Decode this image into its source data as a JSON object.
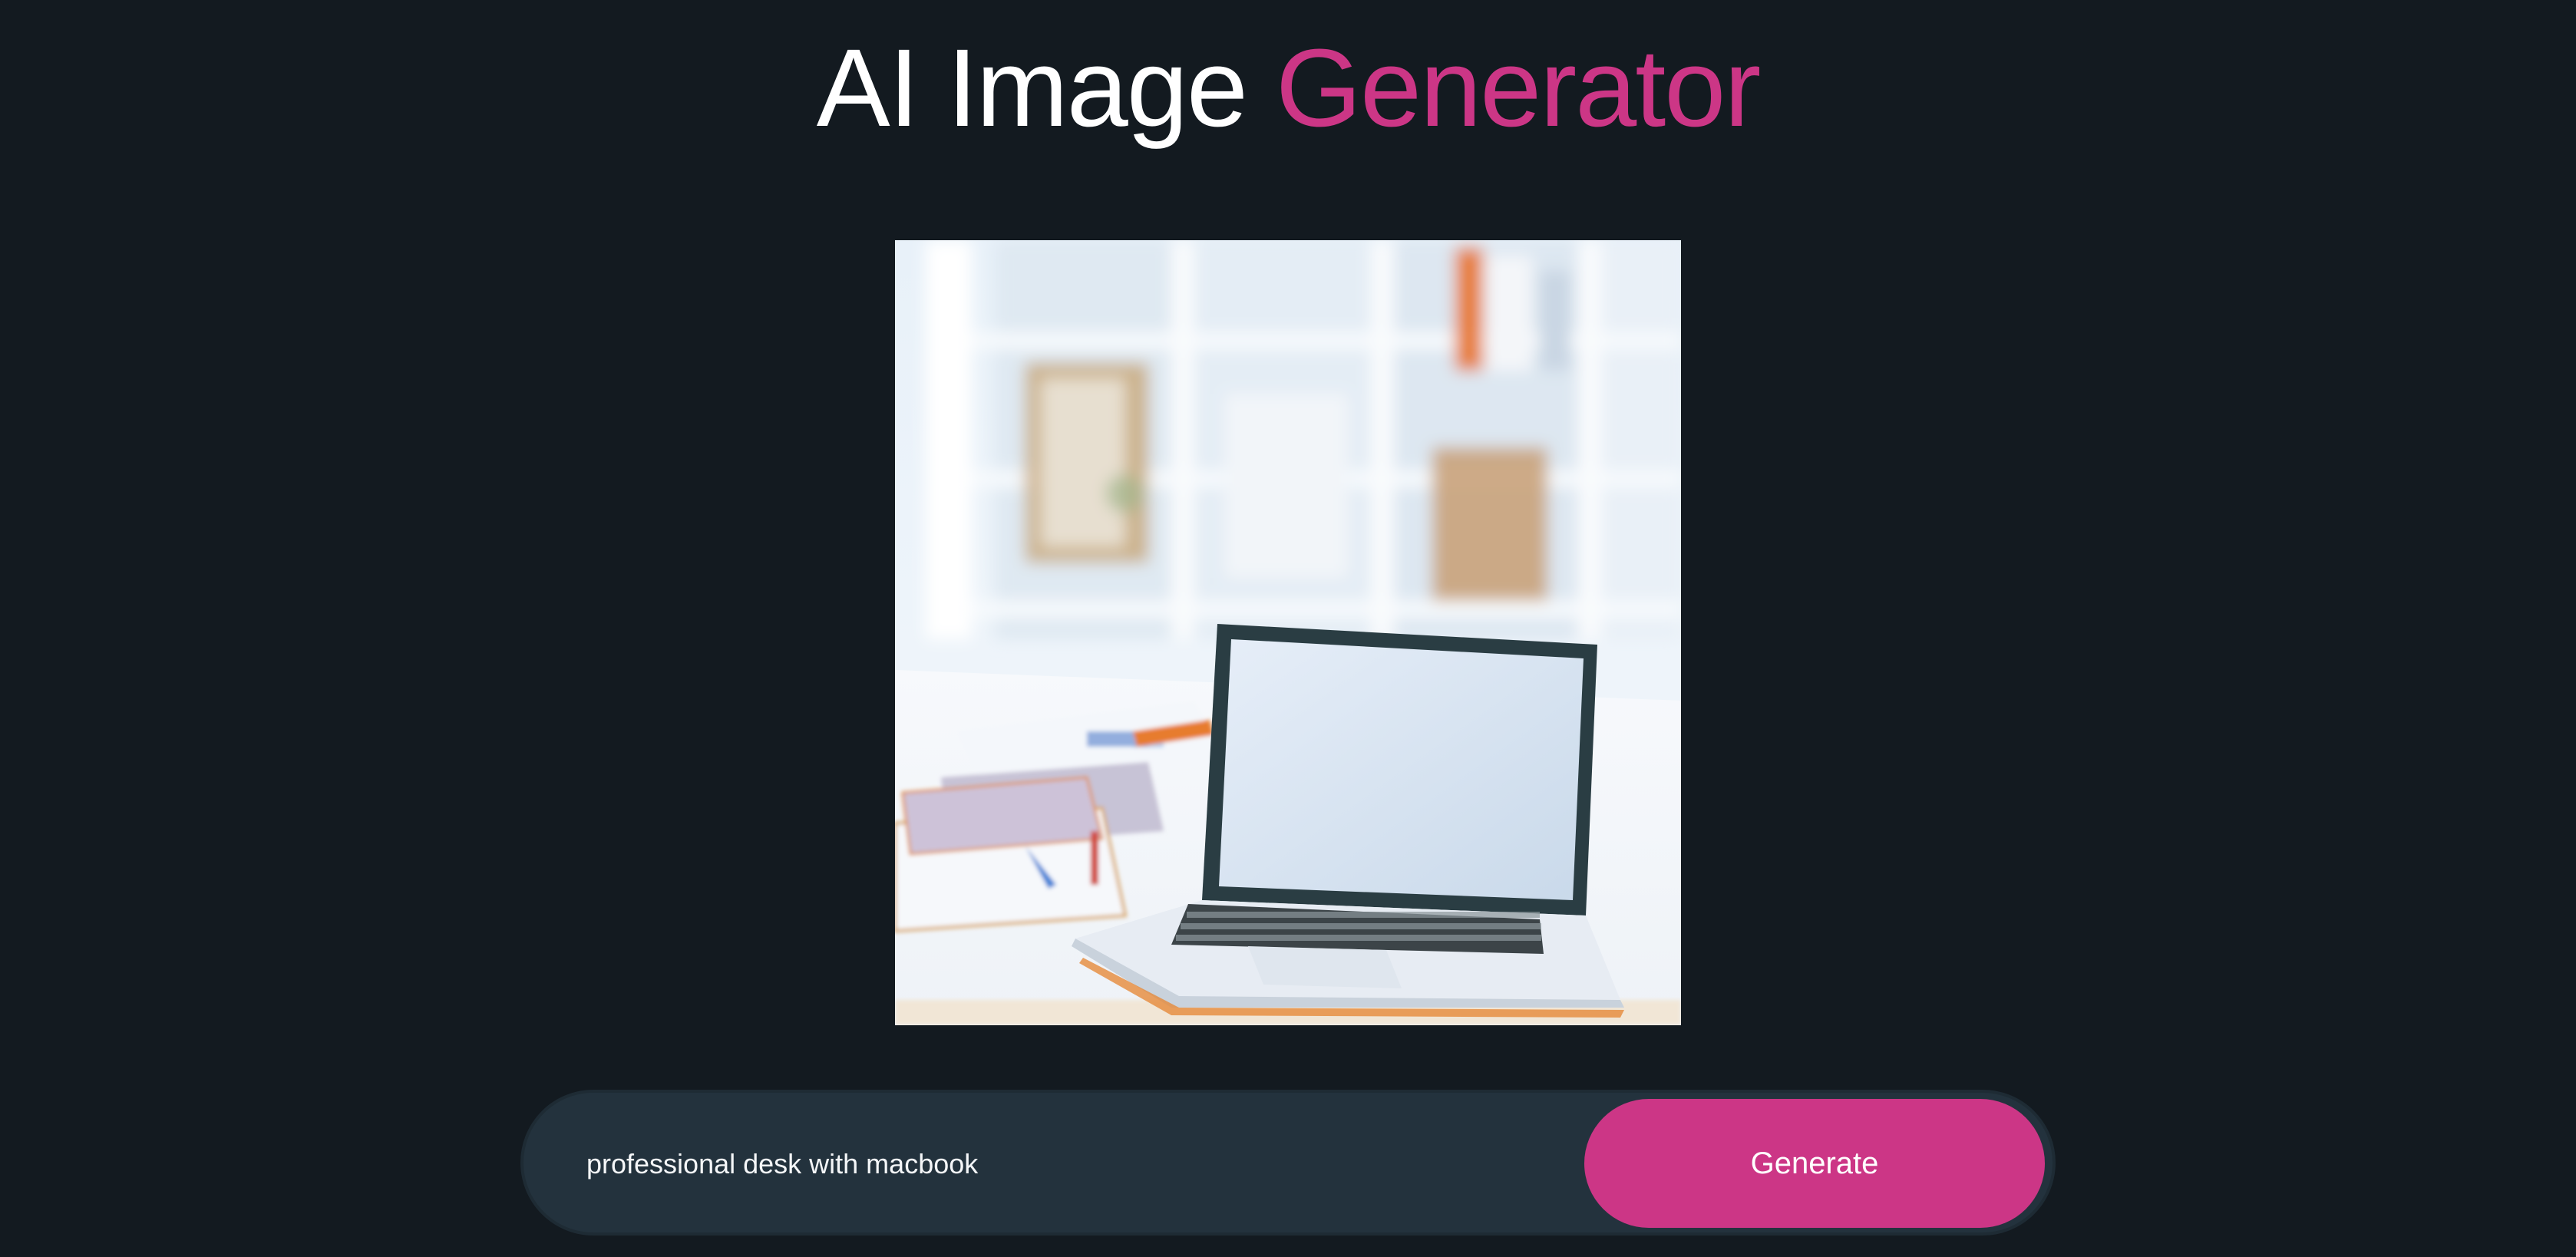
{
  "header": {
    "title_part1": "AI Image",
    "title_part2": "Generator"
  },
  "result_image": {
    "subject": "laptop on office desk",
    "icon": "generated-image"
  },
  "prompt": {
    "value": "professional desk with macbook",
    "button_label": "Generate"
  },
  "colors": {
    "background": "#131a20",
    "accent": "#cc3686",
    "input_bar": "#23323d",
    "text": "#ffffff"
  }
}
